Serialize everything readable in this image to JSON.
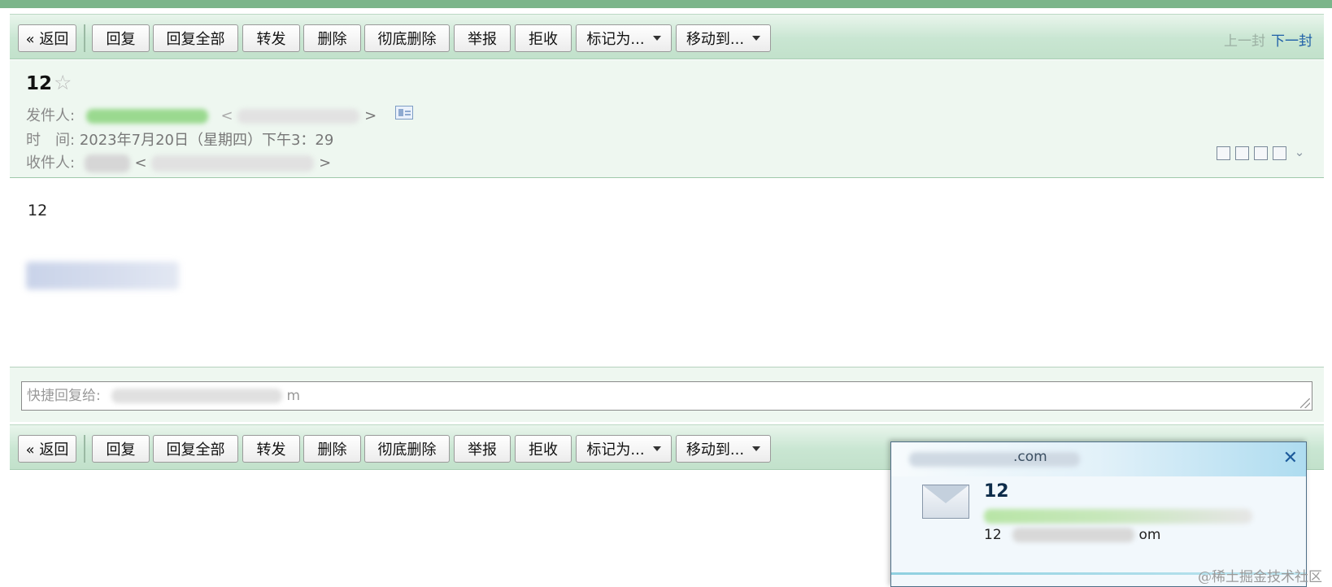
{
  "toolbar": {
    "back": "« 返回",
    "reply": "回复",
    "reply_all": "回复全部",
    "forward": "转发",
    "delete": "删除",
    "delete_permanently": "彻底删除",
    "report": "举报",
    "reject": "拒收",
    "mark_as": "标记为...",
    "move_to": "移动到...",
    "prev_mail": "上一封",
    "next_mail": "下一封"
  },
  "header": {
    "subject": "12",
    "star_icon": "☆",
    "sender_label": "发件人:",
    "sender_email_open": "<",
    "sender_email_close": ">",
    "time_label": "时　间:",
    "time_value": "2023年7月20日（星期四）下午3：29",
    "recipient_label": "收件人:",
    "recipient_open": "<",
    "recipient_close": ">"
  },
  "body": {
    "text": "12"
  },
  "quick_reply": {
    "label": "快捷回复给:",
    "suffix": "m"
  },
  "notification": {
    "subject": "12",
    "preview_prefix": "12",
    "preview_suffix": "om",
    "from_suffix": ".com"
  },
  "watermark": "@稀土掘金技术社区",
  "colors": {
    "toolbar_green": "#c9e6d2",
    "header_bg": "#eef7f0",
    "link_blue": "#1f5fa8"
  }
}
